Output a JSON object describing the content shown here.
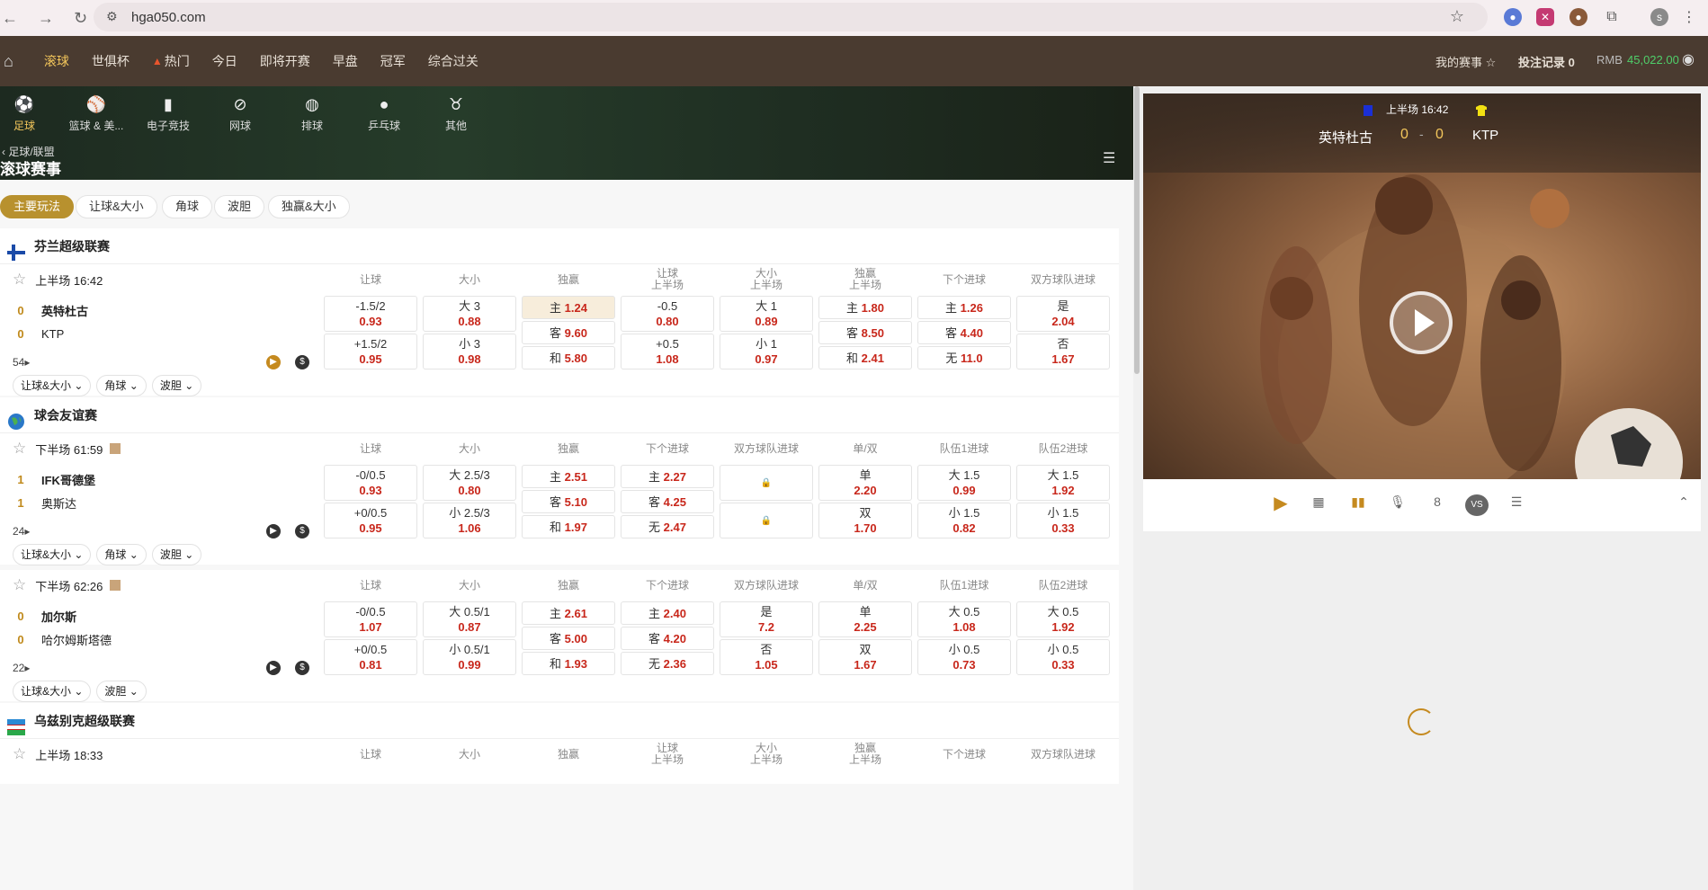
{
  "browser": {
    "url": "hga050.com"
  },
  "nav": {
    "items": [
      "滚球",
      "世俱杯",
      "热门",
      "今日",
      "即将开赛",
      "早盘",
      "冠军",
      "综合过关"
    ],
    "my_events": "我的赛事",
    "bet_record": "投注记录 0",
    "currency": "RMB",
    "balance": "45,022.00"
  },
  "sports": [
    "足球",
    "篮球 & 美...",
    "电子竞技",
    "网球",
    "排球",
    "乒乓球",
    "其他"
  ],
  "section": {
    "breadcrumb": "足球/联盟",
    "title": "滚球赛事"
  },
  "filters": [
    "主要玩法",
    "让球&大小",
    "角球",
    "波胆",
    "独赢&大小"
  ],
  "leagues": [
    {
      "name": "芬兰超级联赛",
      "matches": [
        {
          "time": "上半场 16:42",
          "home": "英特杜古",
          "away": "KTP",
          "home_score": "0",
          "away_score": "0",
          "count": "54",
          "headers": [
            "让球",
            "大小",
            "独赢",
            "让球\n上半场",
            "大小\n上半场",
            "独赢\n上半场",
            "下个进球",
            "双方球队进球"
          ],
          "odds": [
            [
              [
                "-1.5/2",
                "0.93"
              ],
              [
                "大 3",
                "0.88"
              ],
              [
                "主",
                "1.24"
              ],
              [
                "-0.5",
                "0.80"
              ],
              [
                "大 1",
                "0.89"
              ],
              [
                "主",
                "1.80"
              ],
              [
                "主",
                "1.26"
              ],
              [
                "是",
                "2.04"
              ]
            ],
            [
              [
                "+1.5/2",
                "0.95"
              ],
              [
                "小 3",
                "0.98"
              ],
              [
                "客",
                "9.60"
              ],
              [
                "+0.5",
                "1.08"
              ],
              [
                "小 1",
                "0.97"
              ],
              [
                "客",
                "8.50"
              ],
              [
                "客",
                "4.40"
              ],
              [
                "否",
                "1.67"
              ]
            ],
            [
              null,
              null,
              [
                "和",
                "5.80"
              ],
              null,
              null,
              [
                "和",
                "2.41"
              ],
              [
                "无",
                "11.0"
              ],
              null
            ]
          ],
          "dropdowns": [
            "让球&大小",
            "角球",
            "波胆"
          ]
        }
      ]
    },
    {
      "name": "球会友谊赛",
      "matches": [
        {
          "time": "下半场 61:59",
          "home": "IFK哥德堡",
          "away": "奥斯达",
          "home_score": "1",
          "away_score": "1",
          "count": "24",
          "headers": [
            "让球",
            "大小",
            "独赢",
            "下个进球",
            "双方球队进球",
            "单/双",
            "队伍1进球",
            "队伍2进球"
          ],
          "odds": [
            [
              [
                "-0/0.5",
                "0.93"
              ],
              [
                "大 2.5/3",
                "0.80"
              ],
              [
                "主",
                "2.51"
              ],
              [
                "主",
                "2.27"
              ],
              [
                "lock",
                ""
              ],
              [
                "单",
                "2.20"
              ],
              [
                "大 1.5",
                "0.99"
              ],
              [
                "大 1.5",
                "1.92"
              ]
            ],
            [
              [
                "+0/0.5",
                "0.95"
              ],
              [
                "小 2.5/3",
                "1.06"
              ],
              [
                "客",
                "5.10"
              ],
              [
                "客",
                "4.25"
              ],
              [
                "lock",
                ""
              ],
              [
                "双",
                "1.70"
              ],
              [
                "小 1.5",
                "0.82"
              ],
              [
                "小 1.5",
                "0.33"
              ]
            ],
            [
              null,
              null,
              [
                "和",
                "1.97"
              ],
              [
                "无",
                "2.47"
              ],
              null,
              null,
              null,
              null
            ]
          ],
          "dropdowns": [
            "让球&大小",
            "角球",
            "波胆"
          ]
        },
        {
          "time": "下半场 62:26",
          "home": "加尔斯",
          "away": "哈尔姆斯塔德",
          "home_score": "0",
          "away_score": "0",
          "count": "22",
          "headers": [
            "让球",
            "大小",
            "独赢",
            "下个进球",
            "双方球队进球",
            "单/双",
            "队伍1进球",
            "队伍2进球"
          ],
          "odds": [
            [
              [
                "-0/0.5",
                "1.07"
              ],
              [
                "大 0.5/1",
                "0.87"
              ],
              [
                "主",
                "2.61"
              ],
              [
                "主",
                "2.40"
              ],
              [
                "是",
                "7.2"
              ],
              [
                "单",
                "2.25"
              ],
              [
                "大 0.5",
                "1.08"
              ],
              [
                "大 0.5",
                "1.92"
              ]
            ],
            [
              [
                "+0/0.5",
                "0.81"
              ],
              [
                "小 0.5/1",
                "0.99"
              ],
              [
                "客",
                "5.00"
              ],
              [
                "客",
                "4.20"
              ],
              [
                "否",
                "1.05"
              ],
              [
                "双",
                "1.67"
              ],
              [
                "小 0.5",
                "0.73"
              ],
              [
                "小 0.5",
                "0.33"
              ]
            ],
            [
              null,
              null,
              [
                "和",
                "1.93"
              ],
              [
                "无",
                "2.36"
              ],
              null,
              null,
              null,
              null
            ]
          ],
          "dropdowns": [
            "让球&大小",
            "波胆"
          ]
        }
      ]
    },
    {
      "name": "乌兹别克超级联赛",
      "matches": [
        {
          "time": "上半场 18:33",
          "headers": [
            "让球",
            "大小",
            "独赢",
            "让球\n上半场",
            "大小\n上半场",
            "独赢\n上半场",
            "下个进球",
            "双方球队进球"
          ]
        }
      ]
    }
  ],
  "video": {
    "period": "上半场 16:42",
    "home": "英特杜古",
    "away": "KTP",
    "home_score": "0",
    "dash": "-",
    "away_score": "0",
    "home_color": "#1a2fd6",
    "away_color": "#f2e012"
  },
  "controls": [
    "play-icon",
    "field-icon",
    "stats-icon",
    "mic-icon",
    "jersey-icon",
    "vs-icon",
    "list-icon"
  ]
}
